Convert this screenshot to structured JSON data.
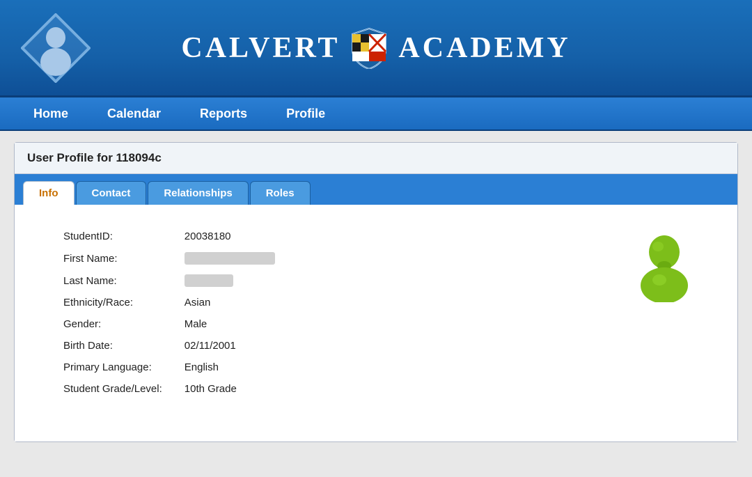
{
  "header": {
    "title_left": "CALVERT",
    "title_right": "ACADEMY"
  },
  "nav": {
    "items": [
      {
        "label": "Home",
        "id": "home"
      },
      {
        "label": "Calendar",
        "id": "calendar"
      },
      {
        "label": "Reports",
        "id": "reports"
      },
      {
        "label": "Profile",
        "id": "profile"
      }
    ]
  },
  "profile": {
    "title": "User Profile for 118094c",
    "tabs": [
      {
        "label": "Info",
        "id": "info",
        "active": true
      },
      {
        "label": "Contact",
        "id": "contact",
        "active": false
      },
      {
        "label": "Relationships",
        "id": "relationships",
        "active": false
      },
      {
        "label": "Roles",
        "id": "roles",
        "active": false
      }
    ],
    "fields": [
      {
        "label": "StudentID:",
        "value": "20038180",
        "redacted": false
      },
      {
        "label": "First Name:",
        "value": "",
        "redacted": "long"
      },
      {
        "label": "Last Name:",
        "value": "",
        "redacted": "short"
      },
      {
        "label": "Ethnicity/Race:",
        "value": "Asian",
        "redacted": false
      },
      {
        "label": "Gender:",
        "value": "Male",
        "redacted": false
      },
      {
        "label": "Birth Date:",
        "value": "02/11/2001",
        "redacted": false
      },
      {
        "label": "Primary Language:",
        "value": "English",
        "redacted": false
      },
      {
        "label": "Student Grade/Level:",
        "value": "10th Grade",
        "redacted": false
      }
    ]
  }
}
